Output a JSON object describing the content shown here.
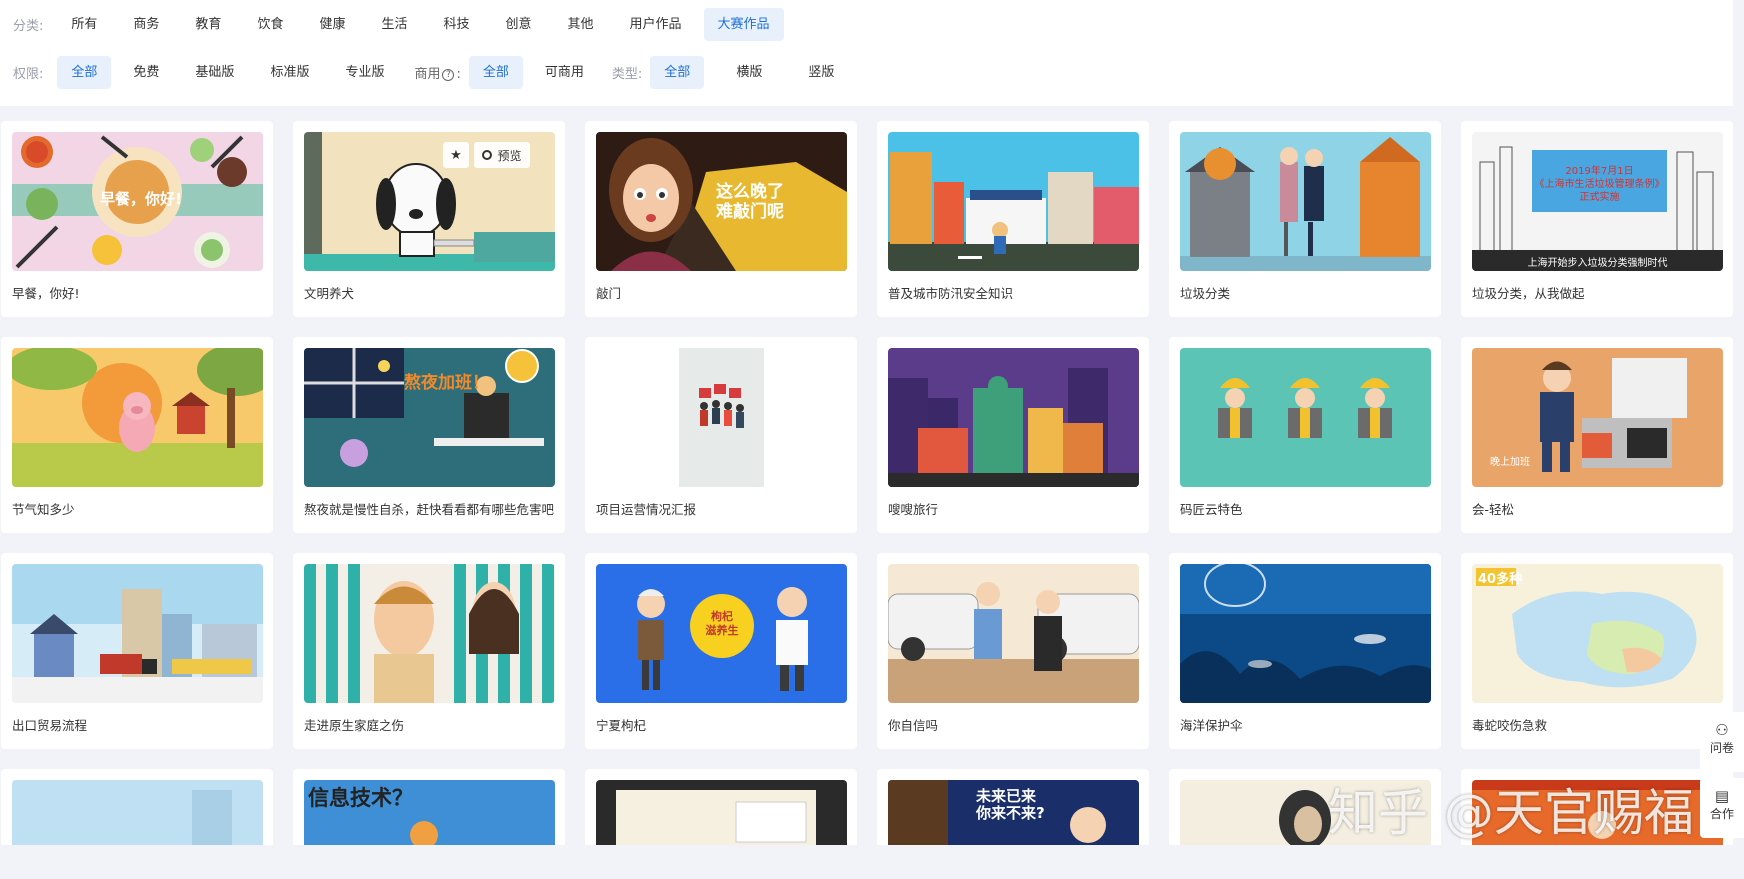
{
  "filters": {
    "category": {
      "label": "分类:",
      "options": [
        "所有",
        "商务",
        "教育",
        "饮食",
        "健康",
        "生活",
        "科技",
        "创意",
        "其他",
        "用户作品",
        "大赛作品"
      ],
      "selected": "大赛作品"
    },
    "permission": {
      "label": "权限:",
      "options": [
        "全部",
        "免费",
        "基础版",
        "标准版",
        "专业版"
      ],
      "selected": "全部"
    },
    "commercial": {
      "label": "商用",
      "help_icon": "?",
      "suffix": ":",
      "options": [
        "全部",
        "可商用"
      ],
      "selected": "全部"
    },
    "type": {
      "label": "类型:",
      "options": [
        "全部",
        "横版",
        "竖版"
      ],
      "selected": "全部"
    }
  },
  "cards": [
    {
      "title": "早餐，你好!",
      "thumb_text": "早餐，你好!"
    },
    {
      "title": "文明养犬",
      "hover": true,
      "favorite_icon": "star-icon",
      "preview_label": "预览"
    },
    {
      "title": "敲门",
      "thumb_text": "这么晚了\n难敲门呢"
    },
    {
      "title": "普及城市防汛安全知识"
    },
    {
      "title": "垃圾分类"
    },
    {
      "title": "垃圾分类，从我做起",
      "thumb_text": "2019年7月1日\n《上海市生活垃圾管理条例》\n正式实施",
      "thumb_caption": "上海开始步入垃圾分类强制时代"
    },
    {
      "title": "节气知多少"
    },
    {
      "title": "熬夜就是慢性自杀，赶快看看都有哪些危害吧",
      "thumb_text": "熬夜加班！"
    },
    {
      "title": "项目运营情况汇报"
    },
    {
      "title": "嗖嗖旅行"
    },
    {
      "title": "码匠云特色"
    },
    {
      "title": "会-轻松",
      "thumb_caption": "晚上加班"
    },
    {
      "title": "出口贸易流程"
    },
    {
      "title": "走进原生家庭之伤"
    },
    {
      "title": "宁夏枸杞",
      "thumb_text": "枸杞\n滋养生"
    },
    {
      "title": "你自信吗"
    },
    {
      "title": "海洋保护伞"
    },
    {
      "title": "毒蛇咬伤急救",
      "thumb_text": "40多种"
    },
    {
      "title": "",
      "partial": true
    },
    {
      "title": "",
      "partial": true,
      "thumb_text": "信息技术？"
    },
    {
      "title": "",
      "partial": true
    },
    {
      "title": "",
      "partial": true,
      "thumb_text": "未来已来\n你来不来?"
    },
    {
      "title": "",
      "partial": true
    },
    {
      "title": "",
      "partial": true
    }
  ],
  "side_panel": {
    "items": [
      {
        "label": "问卷",
        "icon": "handshake-icon"
      },
      {
        "label": "合作",
        "icon": "clipboard-icon"
      }
    ]
  },
  "watermark": "知乎 @天官赐福",
  "colors": {
    "accent": "#1d6fd6",
    "selected_bg": "#e8f0fb",
    "page_bg": "#f1f3f8"
  }
}
